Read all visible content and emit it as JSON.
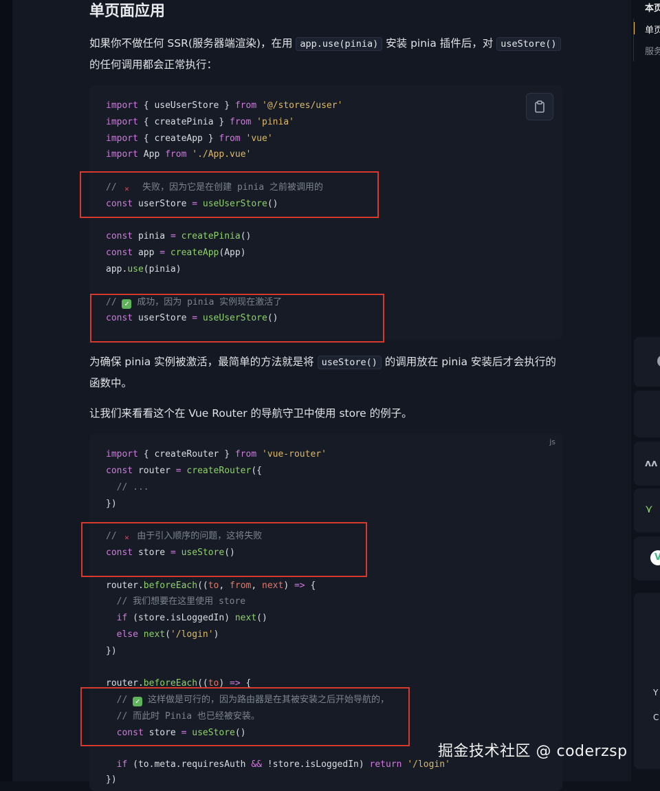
{
  "article": {
    "heading": "单页面应用",
    "para1_a": "如果你不做任何 SSR(服务器端渲染)，在用",
    "para1_code1": "app.use(pinia)",
    "para1_b": "安装 pinia 插件后，对",
    "para1_code2": "useStore()",
    "para1_c": "的任何调用都会正常执行：",
    "para2_a": "为确保 pinia 实例被激活，最简单的方法就是将",
    "para2_code": "useStore()",
    "para2_b": "的调用放在 pinia 安装后才会执行的函数中。",
    "para3": "让我们来看看这个在 Vue Router 的导航守卫中使用 store 的例子。"
  },
  "code1": {
    "l1_kw": "import",
    "l1_mid": " { useUserStore } ",
    "l1_from": "from",
    "l1_str": " '@/stores/user'",
    "l2_kw": "import",
    "l2_mid": " { createPinia } ",
    "l2_from": "from",
    "l2_str": " 'pinia'",
    "l3_kw": "import",
    "l3_mid": " { createApp } ",
    "l3_from": "from",
    "l3_str": " 'vue'",
    "l4_kw": "import",
    "l4_mid": " App ",
    "l4_from": "from",
    "l4_str": " './App.vue'",
    "c1_a": "// ",
    "c1_b": "  失败，因为它是在创建 pinia 之前被调用的",
    "l6_kw": "const",
    "l6_mid": " userStore ",
    "l6_op": "=",
    "l6_fn": " useUserStore",
    "l6_end": "()",
    "l7_kw": "const",
    "l7_mid": " pinia ",
    "l7_op": "=",
    "l7_fn": " createPinia",
    "l7_end": "()",
    "l8_kw": "const",
    "l8_mid": " app ",
    "l8_op": "=",
    "l8_fn": " createApp",
    "l8_end": "(App)",
    "l9_a": "app.",
    "l9_fn": "use",
    "l9_end": "(pinia)",
    "c2_a": "// ",
    "c2_b": " 成功，因为 pinia 实例现在激活了",
    "l11_kw": "const",
    "l11_mid": " userStore ",
    "l11_op": "=",
    "l11_fn": " useUserStore",
    "l11_end": "()"
  },
  "code2": {
    "lang": "js",
    "l1_kw": "import",
    "l1_mid": " { createRouter } ",
    "l1_from": "from",
    "l1_str": " 'vue-router'",
    "l2_kw": "const",
    "l2_mid": " router ",
    "l2_op": "=",
    "l2_fn": " createRouter",
    "l2_end": "({",
    "l3": "  // ...",
    "l4": "})",
    "c1_a": "// ",
    "c1_b": " 由于引入顺序的问题，这将失败",
    "l6_kw": "const",
    "l6_mid": " store ",
    "l6_op": "=",
    "l6_fn": " useStore",
    "l6_end": "()",
    "l7_a": "router.",
    "l7_fn": "beforeEach",
    "l7_b": "((",
    "l7_p1": "to",
    "l7_c": ", ",
    "l7_p2": "from",
    "l7_d": ", ",
    "l7_p3": "next",
    "l7_e": ") ",
    "l7_op": "=>",
    "l7_f": " {",
    "l8": "  // 我们想要在这里使用 store",
    "l9_kw": "  if",
    "l9_mid": " (store.isLoggedIn) ",
    "l9_fn": "next",
    "l9_end": "()",
    "l10_kw": "  else",
    "l10_fn": " next",
    "l10_a": "(",
    "l10_str": "'/login'",
    "l10_b": ")",
    "l11": "})",
    "l12_a": "router.",
    "l12_fn": "beforeEach",
    "l12_b": "((",
    "l12_p1": "to",
    "l12_e": ") ",
    "l12_op": "=>",
    "l12_f": " {",
    "c2_a": "  // ",
    "c2_b": " 这样做是可行的，因为路由器是在其被安装之后开始导航的，",
    "c3": "  // 而此时 Pinia 也已经被安装。",
    "l15_kw": "  const",
    "l15_mid": " store ",
    "l15_op": "=",
    "l15_fn": " useStore",
    "l15_end": "()",
    "l16_kw": "  if",
    "l16_mid": " (to.meta.requiresAuth ",
    "l16_op": "&&",
    "l16_mid2": " !store.isLoggedIn) ",
    "l16_kw2": "return",
    "l16_str": " '/login'",
    "l17": "})"
  },
  "toc": {
    "item1": "本页",
    "item2": "单页",
    "item3": "服务"
  },
  "right_cards": {
    "c1": "Y",
    "c2": "C"
  },
  "watermark": "掘金技术社区 @ coderzsp",
  "colors": {
    "keyword": "#d17ae0",
    "function": "#8fd16a",
    "string": "#dfb966",
    "comment": "#7d848f",
    "highlight_box": "#d63a2f",
    "toc_active": "#f5c542"
  },
  "icons": {
    "copy": "clipboard-icon",
    "cross": "cross-mark-icon",
    "check": "check-mark-icon"
  }
}
